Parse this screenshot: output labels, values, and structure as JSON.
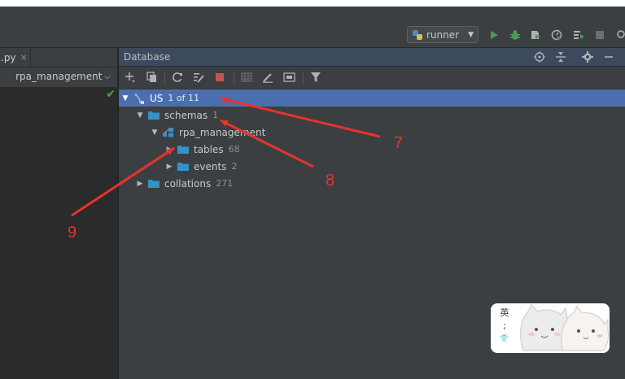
{
  "toolbar": {
    "run_config": "runner",
    "colors": {
      "run": "#499c54",
      "stop": "#6e6e6e"
    },
    "icons": [
      "python-icon",
      "run-icon",
      "debug-icon",
      "coverage-icon",
      "profile-icon",
      "run-tests-icon",
      "stop-icon",
      "search-icon"
    ]
  },
  "editor": {
    "tab_label": ".py",
    "tab_close": "×",
    "breadcrumb": "rpa_management",
    "breadcrumb_caret": "⌵",
    "check_mark": "✔"
  },
  "database_panel": {
    "title": "Database",
    "header_icons": [
      "target-icon",
      "collapse-icon",
      "gear-icon",
      "minimize-icon"
    ],
    "toolbar_icons": [
      "add-icon",
      "copy-icon",
      "refresh-icon",
      "edit-properties-icon",
      "stop-icon",
      "table-view-icon",
      "edit-icon",
      "console-icon",
      "filter-icon"
    ]
  },
  "tree": {
    "items": [
      {
        "label": "US",
        "count": "1 of 11",
        "icon": "datasource-icon",
        "expanded": true,
        "selected": true
      },
      {
        "label": "schemas",
        "count": "1",
        "icon": "folder-icon",
        "expanded": true
      },
      {
        "label": "rpa_management",
        "count": "",
        "icon": "schema-icon",
        "expanded": true
      },
      {
        "label": "tables",
        "count": "68",
        "icon": "folder-icon",
        "expanded": false
      },
      {
        "label": "events",
        "count": "2",
        "icon": "folder-icon",
        "expanded": false
      },
      {
        "label": "collations",
        "count": "271",
        "icon": "folder-icon",
        "expanded": false
      }
    ]
  },
  "annotations": {
    "n7": "7",
    "n8": "8",
    "n9": "9",
    "color": "#e8332c"
  },
  "sticker": {
    "ime_char": "英",
    "ime_punct": ";",
    "ime_shirt": "👕"
  }
}
